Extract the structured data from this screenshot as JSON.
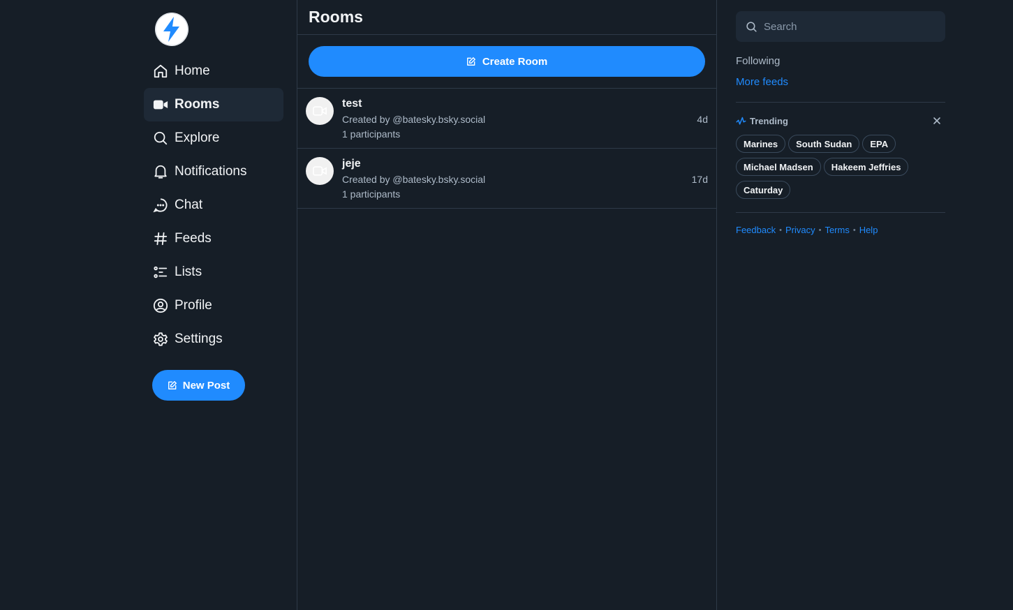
{
  "nav": {
    "items": [
      {
        "label": "Home",
        "icon": "home-icon"
      },
      {
        "label": "Rooms",
        "icon": "video-camera-icon",
        "active": true
      },
      {
        "label": "Explore",
        "icon": "search-icon"
      },
      {
        "label": "Notifications",
        "icon": "bell-icon"
      },
      {
        "label": "Chat",
        "icon": "chat-bubble-icon"
      },
      {
        "label": "Feeds",
        "icon": "hashtag-icon"
      },
      {
        "label": "Lists",
        "icon": "list-icon"
      },
      {
        "label": "Profile",
        "icon": "user-circle-icon"
      },
      {
        "label": "Settings",
        "icon": "gear-icon"
      }
    ],
    "new_post_label": "New Post"
  },
  "main": {
    "title": "Rooms",
    "create_label": "Create Room",
    "rooms": [
      {
        "name": "test",
        "creator": "Created by @batesky.bsky.social",
        "participants": "1 participants",
        "age": "4d"
      },
      {
        "name": "jeje",
        "creator": "Created by @batesky.bsky.social",
        "participants": "1 participants",
        "age": "17d"
      }
    ]
  },
  "sidebar": {
    "search_placeholder": "Search",
    "following_label": "Following",
    "more_feeds_label": "More feeds",
    "trending_title": "Trending",
    "trending": [
      "Marines",
      "South Sudan",
      "EPA",
      "Michael Madsen",
      "Hakeem Jeffries",
      "Caturday"
    ],
    "footer": [
      "Feedback",
      "Privacy",
      "Terms",
      "Help"
    ]
  },
  "colors": {
    "background": "#161e27",
    "accent": "#208bfe",
    "border": "#2e3a48",
    "muted_text": "#aebbc9"
  }
}
